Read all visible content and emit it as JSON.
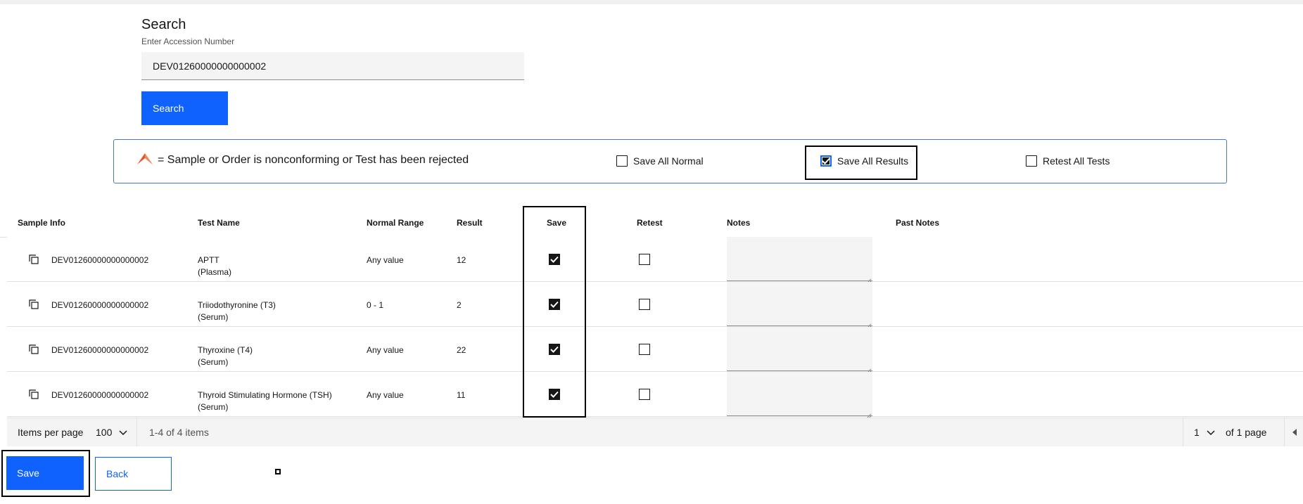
{
  "search": {
    "title": "Search",
    "label": "Enter Accession Number",
    "value": "DEV01260000000000002",
    "button_label": "Search"
  },
  "legend": {
    "text": "= Sample or Order is nonconforming or Test has been rejected",
    "save_all_normal": "Save All Normal",
    "save_all_results": "Save All Results",
    "retest_all_tests": "Retest All Tests",
    "save_all_normal_checked": false,
    "save_all_results_checked": true,
    "retest_all_tests_checked": false,
    "icon_color": "#e8542a"
  },
  "table": {
    "headers": {
      "sample_info": "Sample Info",
      "test_name": "Test Name",
      "normal_range": "Normal Range",
      "result": "Result",
      "save": "Save",
      "retest": "Retest",
      "notes": "Notes",
      "past_notes": "Past Notes"
    },
    "rows": [
      {
        "sample": "DEV01260000000000002",
        "test": "APTT",
        "specimen": "(Plasma)",
        "range": "Any value",
        "result": "12",
        "save": true,
        "retest": false
      },
      {
        "sample": "DEV01260000000000002",
        "test": "Triiodothyronine (T3)",
        "specimen": "(Serum)",
        "range": "0 - 1",
        "result": "2",
        "save": true,
        "retest": false
      },
      {
        "sample": "DEV01260000000000002",
        "test": "Thyroxine (T4)",
        "specimen": "(Serum)",
        "range": "Any value",
        "result": "22",
        "save": true,
        "retest": false
      },
      {
        "sample": "DEV01260000000000002",
        "test": "Thyroid Stimulating Hormone (TSH)",
        "specimen": "(Serum)",
        "range": "Any value",
        "result": "11",
        "save": true,
        "retest": false
      }
    ]
  },
  "pagination": {
    "items_per_page_label": "Items per page",
    "items_per_page": "100",
    "range_text": "1-4 of 4 items",
    "page": "1",
    "of_pages": "of 1 page"
  },
  "actions": {
    "save_label": "Save",
    "back_label": "Back"
  },
  "colors": {
    "primary": "#0f62fe",
    "field_bg": "#f4f4f4"
  }
}
